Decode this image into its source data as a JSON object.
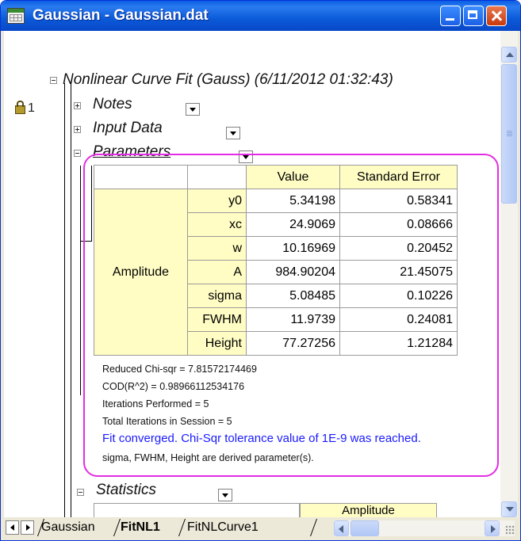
{
  "window": {
    "title": "Gaussian - Gaussian.dat"
  },
  "tree": {
    "node_number": "1",
    "root_title": "Nonlinear Curve Fit (Gauss) (6/11/2012 01:32:43)",
    "notes_label": "Notes",
    "input_data_label": "Input Data",
    "parameters_label": "Parameters",
    "statistics_label": "Statistics"
  },
  "parameters": {
    "header_value": "Value",
    "header_error": "Standard Error",
    "group_label": "Amplitude",
    "rows": [
      {
        "name": "y0",
        "value": "5.34198",
        "error": "0.58341"
      },
      {
        "name": "xc",
        "value": "24.9069",
        "error": "0.08666"
      },
      {
        "name": "w",
        "value": "10.16969",
        "error": "0.20452"
      },
      {
        "name": "A",
        "value": "984.90204",
        "error": "21.45075"
      },
      {
        "name": "sigma",
        "value": "5.08485",
        "error": "0.10226"
      },
      {
        "name": "FWHM",
        "value": "11.9739",
        "error": "0.24081"
      },
      {
        "name": "Height",
        "value": "77.27256",
        "error": "1.21284"
      }
    ],
    "notes": {
      "chi_sqr": "Reduced Chi-sqr = 7.81572174469",
      "cod": "COD(R^2) = 0.98966112534176",
      "iterations": "Iterations Performed = 5",
      "total_iterations": "Total Iterations in Session = 5",
      "converged": "Fit converged. Chi-Sqr tolerance value of 1E-9 was reached.",
      "derived": "sigma, FWHM, Height are derived parameter(s)."
    }
  },
  "statistics": {
    "header": "Amplitude"
  },
  "sheet_tabs": [
    "Gaussian",
    "FitNL1",
    "FitNLCurve1"
  ],
  "active_tab": "FitNL1",
  "colors": {
    "highlight": "#e32de3",
    "header_bg": "#fffdc4",
    "converged_text": "#1a1aff"
  }
}
